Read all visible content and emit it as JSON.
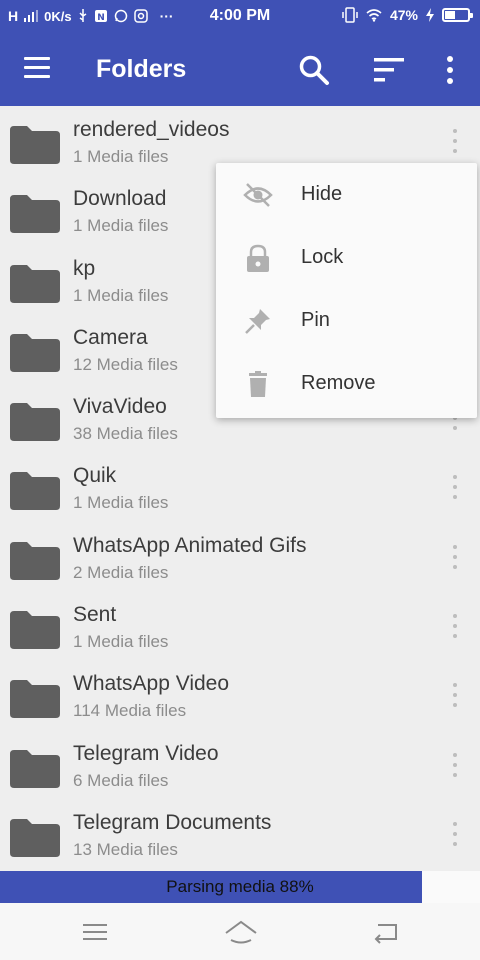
{
  "status_bar": {
    "network": "H",
    "data_speed": "0K/s",
    "more": "···",
    "time": "4:00 PM",
    "battery_percent": "47%",
    "battery_level": 0.47
  },
  "app_bar": {
    "title": "Folders"
  },
  "folders": [
    {
      "name": "rendered_videos",
      "count": "1 Media files"
    },
    {
      "name": "Download",
      "count": "1 Media files"
    },
    {
      "name": "kp",
      "count": "1 Media files"
    },
    {
      "name": "Camera",
      "count": "12 Media files"
    },
    {
      "name": "VivaVideo",
      "count": "38 Media files"
    },
    {
      "name": "Quik",
      "count": "1 Media files"
    },
    {
      "name": "WhatsApp Animated Gifs",
      "count": "2 Media files"
    },
    {
      "name": "Sent",
      "count": "1 Media files"
    },
    {
      "name": "WhatsApp Video",
      "count": "114 Media files"
    },
    {
      "name": "Telegram Video",
      "count": "6 Media files"
    },
    {
      "name": "Telegram Documents",
      "count": "13 Media files"
    }
  ],
  "popup_menu": {
    "items": [
      {
        "label": "Hide",
        "icon": "eye-off-icon"
      },
      {
        "label": "Lock",
        "icon": "lock-icon"
      },
      {
        "label": "Pin",
        "icon": "pin-icon"
      },
      {
        "label": "Remove",
        "icon": "trash-icon"
      }
    ]
  },
  "progress": {
    "label": "Parsing media 88%",
    "value": 0.88
  },
  "colors": {
    "primary": "#3f51b5",
    "folder_icon": "#5f5f5f",
    "menu_icon": "#b0b0b0",
    "background": "#eeeeee"
  }
}
